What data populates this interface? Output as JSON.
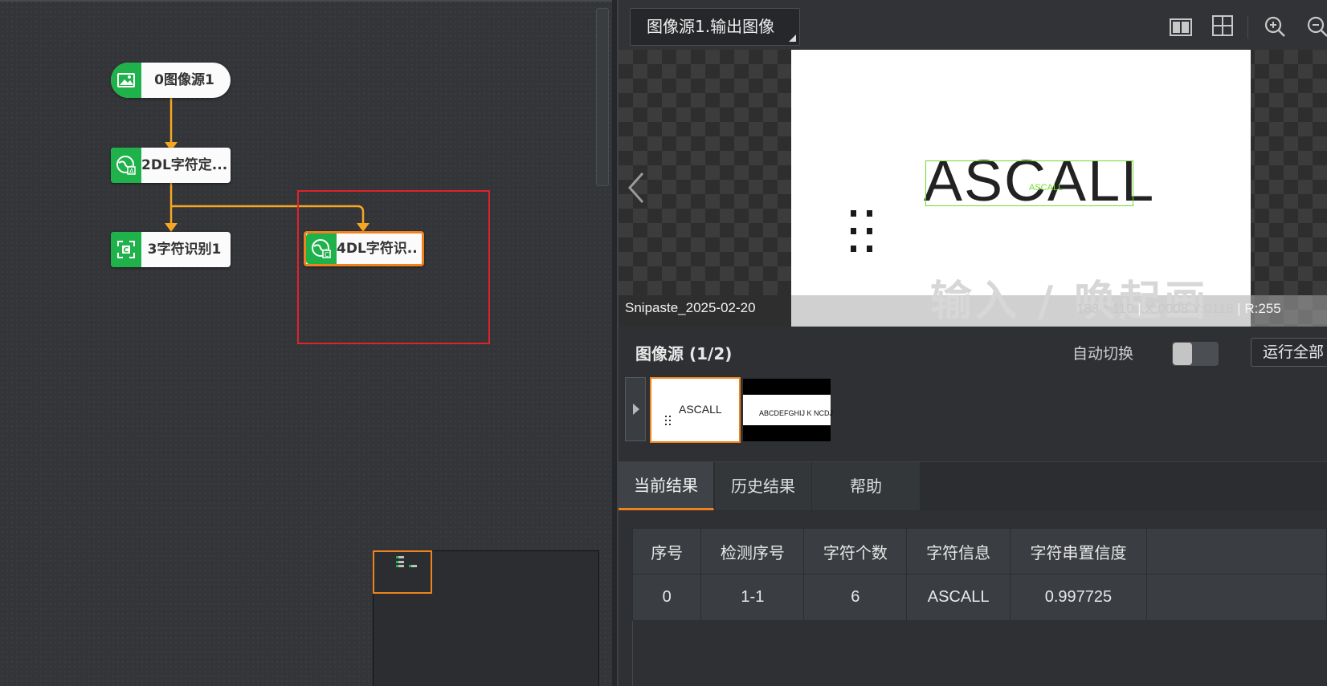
{
  "flow": {
    "nodes": [
      {
        "label": "0图像源1",
        "icon": "image-icon"
      },
      {
        "label": "2DL字符定...",
        "icon": "dl-locate-icon"
      },
      {
        "label": "3字符识别1",
        "icon": "ocr-icon"
      },
      {
        "label": "4DL字符识...",
        "icon": "dl-ocr-icon"
      }
    ],
    "colors": {
      "node_icon": "#1fb24a",
      "link": "#f5a623",
      "selected": "#f0821e",
      "highlight_box": "#e0222a"
    }
  },
  "toolbar": {
    "source_select": "图像源1.输出图像",
    "icons": [
      "layout-split-icon",
      "layout-grid-icon",
      "zoom-in-icon",
      "zoom-out-icon"
    ]
  },
  "viewer": {
    "image_text": "ASCALL",
    "detection_label": "ASCALL",
    "watermark": "输入 / 唤起画",
    "filename": "Snipaste_2025-02-20",
    "size": "183 * 110",
    "x": "X:0008",
    "y": "Y:0118",
    "r": "R:255",
    "sep": "|"
  },
  "source_panel": {
    "title": "图像源 (1/2)",
    "auto_switch_label": "自动切换",
    "run_all_label": "运行全部",
    "thumbs": [
      {
        "text": "ASCALL"
      },
      {
        "text": "ABCDEFGHIJ K  NCDJ"
      }
    ]
  },
  "tabs": [
    {
      "label": "当前结果",
      "active": true
    },
    {
      "label": "历史结果",
      "active": false
    },
    {
      "label": "帮助",
      "active": false
    }
  ],
  "results": {
    "columns": [
      "序号",
      "检测序号",
      "字符个数",
      "字符信息",
      "字符串置信度"
    ],
    "rows": [
      [
        "0",
        "1-1",
        "6",
        "ASCALL",
        "0.997725"
      ]
    ]
  }
}
